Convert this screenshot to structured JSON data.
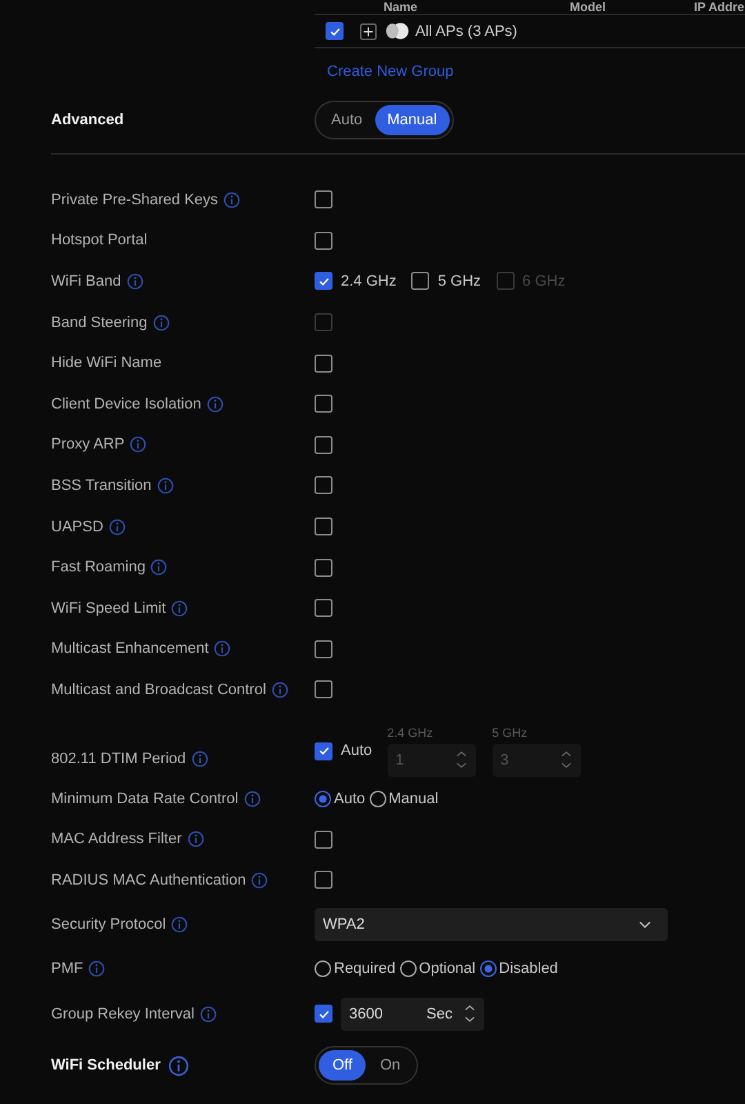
{
  "ap_table": {
    "columns": [
      "Name",
      "Model",
      "IP Addre"
    ],
    "rows": [
      {
        "checked": true,
        "name": "All APs (3 APs)"
      }
    ],
    "create_link": "Create New Group"
  },
  "advanced": {
    "label": "Advanced",
    "options": [
      {
        "label": "Auto",
        "selected": false
      },
      {
        "label": "Manual",
        "selected": true
      }
    ]
  },
  "settings": [
    {
      "kind": "checkbox",
      "label": "Private Pre-Shared Keys",
      "info": true,
      "checked": false,
      "disabled": false
    },
    {
      "kind": "checkbox",
      "label": "Hotspot Portal",
      "info": false,
      "checked": false,
      "disabled": false
    },
    {
      "kind": "checkgroup",
      "label": "WiFi Band",
      "info": true,
      "options": [
        {
          "label": "2.4 GHz",
          "checked": true,
          "disabled": false
        },
        {
          "label": "5 GHz",
          "checked": false,
          "disabled": false
        },
        {
          "label": "6 GHz",
          "checked": false,
          "disabled": true
        }
      ]
    },
    {
      "kind": "checkbox",
      "label": "Band Steering",
      "info": true,
      "checked": false,
      "disabled": true
    },
    {
      "kind": "checkbox",
      "label": "Hide WiFi Name",
      "info": false,
      "checked": false,
      "disabled": false
    },
    {
      "kind": "checkbox",
      "label": "Client Device Isolation",
      "info": true,
      "checked": false,
      "disabled": false
    },
    {
      "kind": "checkbox",
      "label": "Proxy ARP",
      "info": true,
      "checked": false,
      "disabled": false
    },
    {
      "kind": "checkbox",
      "label": "BSS Transition",
      "info": true,
      "checked": false,
      "disabled": false
    },
    {
      "kind": "checkbox",
      "label": "UAPSD",
      "info": true,
      "checked": false,
      "disabled": false
    },
    {
      "kind": "checkbox",
      "label": "Fast Roaming",
      "info": true,
      "checked": false,
      "disabled": false
    },
    {
      "kind": "checkbox",
      "label": "WiFi Speed Limit",
      "info": true,
      "checked": false,
      "disabled": false
    },
    {
      "kind": "checkbox",
      "label": "Multicast Enhancement",
      "info": true,
      "checked": false,
      "disabled": false
    },
    {
      "kind": "checkbox",
      "label": "Multicast and Broadcast Control",
      "info": true,
      "checked": false,
      "disabled": false
    },
    {
      "kind": "dtim",
      "label": "802.11 DTIM Period",
      "info": true,
      "checked": true,
      "check_label": "Auto",
      "fields": [
        {
          "label": "2.4 GHz",
          "value": "1"
        },
        {
          "label": "5 GHz",
          "value": "3"
        }
      ]
    },
    {
      "kind": "radio",
      "label": "Minimum Data Rate Control",
      "info": true,
      "options": [
        {
          "label": "Auto",
          "selected": true
        },
        {
          "label": "Manual",
          "selected": false
        }
      ]
    },
    {
      "kind": "checkbox",
      "label": "MAC Address Filter",
      "info": true,
      "checked": false,
      "disabled": false
    },
    {
      "kind": "checkbox",
      "label": "RADIUS MAC Authentication",
      "info": true,
      "checked": false,
      "disabled": false
    },
    {
      "kind": "select",
      "label": "Security Protocol",
      "info": true,
      "value": "WPA2"
    },
    {
      "kind": "radio",
      "label": "PMF",
      "info": true,
      "options": [
        {
          "label": "Required",
          "selected": false
        },
        {
          "label": "Optional",
          "selected": false
        },
        {
          "label": "Disabled",
          "selected": true
        }
      ]
    },
    {
      "kind": "rekey",
      "label": "Group Rekey Interval",
      "info": true,
      "checked": true,
      "value": "3600",
      "unit": "Sec"
    }
  ],
  "scheduler": {
    "label": "WiFi Scheduler",
    "info": true,
    "options": [
      {
        "label": "Off",
        "selected": true
      },
      {
        "label": "On",
        "selected": false
      }
    ]
  }
}
